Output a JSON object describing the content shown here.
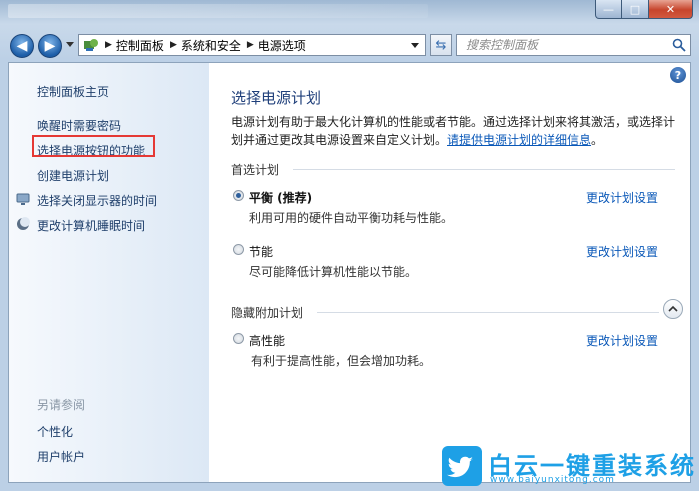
{
  "window": {
    "controls": {
      "minimize": "—",
      "maximize": "□",
      "close": "✕"
    }
  },
  "nav": {
    "back_icon": "arrow-left",
    "forward_icon": "arrow-right",
    "breadcrumbs": [
      "控制面板",
      "系统和安全",
      "电源选项"
    ],
    "search_placeholder": "搜索控制面板"
  },
  "sidebar": {
    "home": "控制面板主页",
    "items": [
      {
        "label": "唤醒时需要密码"
      },
      {
        "label": "选择电源按钮的功能",
        "highlighted": true
      },
      {
        "label": "创建电源计划"
      },
      {
        "label": "选择关闭显示器的时间",
        "icon": "monitor-icon"
      },
      {
        "label": "更改计算机睡眠时间",
        "icon": "moon-icon"
      }
    ],
    "see_also_title": "另请参阅",
    "see_also": [
      "个性化",
      "用户帐户"
    ]
  },
  "main": {
    "help_icon": "?",
    "title": "选择电源计划",
    "description_line1": "电源计划有助于最大化计算机的性能或者节能。通过选择计划来将其激活，或选择计",
    "description_line2": "划并通过更改其电源设置来自定义计划。",
    "description_link": "请提供电源计划的详细信息",
    "description_end": "。",
    "preferred_title": "首选计划",
    "hidden_title": "隐藏附加计划",
    "plans": [
      {
        "name": "平衡 (推荐)",
        "desc": "利用可用的硬件自动平衡功耗与性能。",
        "selected": true,
        "link": "更改计划设置"
      },
      {
        "name": "节能",
        "desc": "尽可能降低计算机性能以节能。",
        "selected": false,
        "link": "更改计划设置"
      },
      {
        "name": "高性能",
        "desc": "有利于提高性能，但会增加功耗。",
        "selected": false,
        "link": "更改计划设置"
      }
    ]
  },
  "watermark": {
    "title": "白云一键重装系统",
    "url": "www.baiyunxitong.com"
  },
  "colors": {
    "link": "#0a58b8",
    "title": "#1f3f7a",
    "highlight_box": "#e53935",
    "watermark": "#1ea0e6"
  }
}
